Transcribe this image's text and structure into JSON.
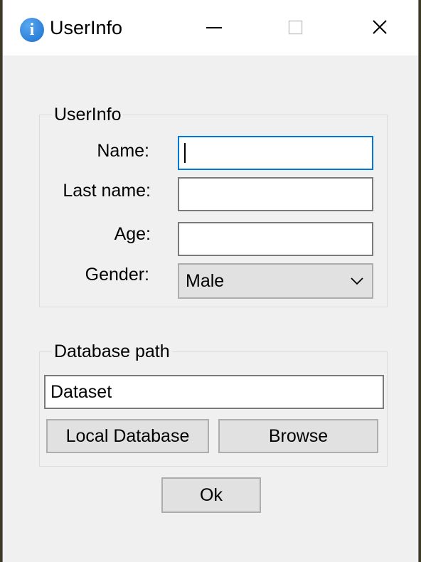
{
  "window": {
    "title": "UserInfo",
    "icon": "info-icon"
  },
  "titlebar": {
    "minimize": "minimize-icon",
    "maximize": "maximize-icon",
    "close": "close-icon"
  },
  "userinfo_group": {
    "title": "UserInfo",
    "name_label": "Name:",
    "name_value": "",
    "lastname_label": "Last name:",
    "lastname_value": "",
    "age_label": "Age:",
    "age_value": "",
    "gender_label": "Gender:",
    "gender_value": "Male"
  },
  "database_group": {
    "title": "Database path",
    "path_value": "Dataset",
    "local_button": "Local Database",
    "browse_button": "Browse"
  },
  "ok_button": "Ok",
  "colors": {
    "accent": "#0078d7",
    "window_bg": "#f0f0f0",
    "button_bg": "#e1e1e1"
  }
}
